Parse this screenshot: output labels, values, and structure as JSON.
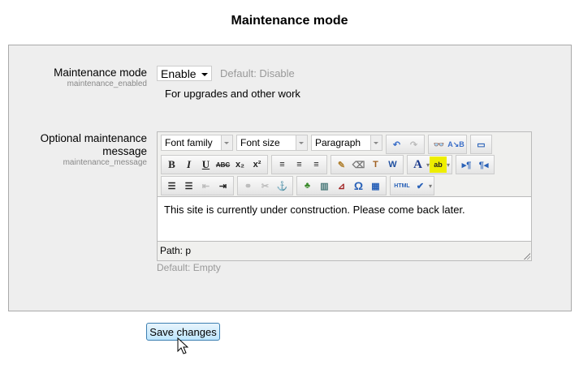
{
  "page": {
    "title": "Maintenance mode"
  },
  "maintenance_mode": {
    "label": "Maintenance mode",
    "key": "maintenance_enabled",
    "value": "Enable",
    "default": "Default: Disable",
    "description": "For upgrades and other work"
  },
  "message": {
    "label_line1": "Optional maintenance",
    "label_line2": "message",
    "key": "maintenance_message",
    "toolbar": {
      "font_family": "Font family",
      "font_size": "Font size",
      "format": "Paragraph"
    },
    "content": "This site is currently under construction. Please come back later.",
    "path": "Path: p",
    "default": "Default: Empty"
  },
  "actions": {
    "save": "Save changes"
  }
}
